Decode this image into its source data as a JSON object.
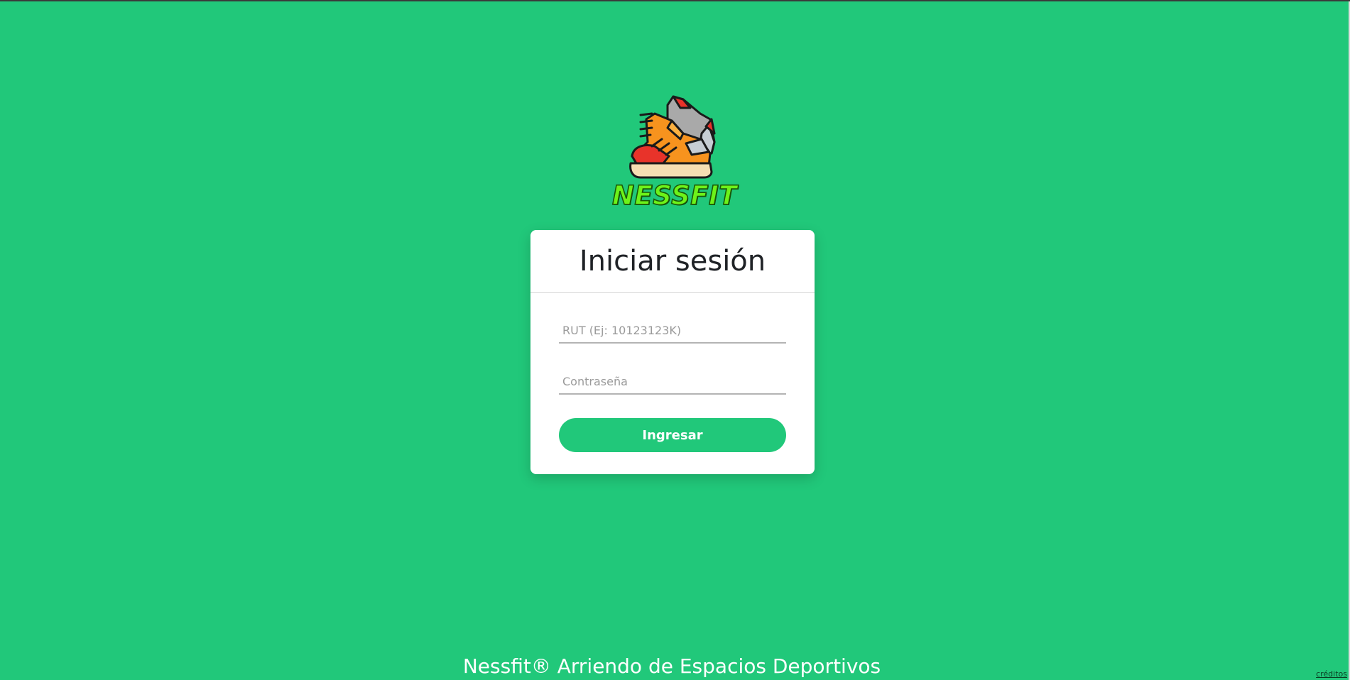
{
  "brand": {
    "logo_text": "NESSFIT",
    "logo_icon": "sneakers-icon"
  },
  "login": {
    "title": "Iniciar sesión",
    "rut_placeholder": "RUT (Ej: 10123123K)",
    "rut_value": "",
    "password_placeholder": "Contraseña",
    "password_value": "",
    "submit_label": "Ingresar"
  },
  "footer": {
    "text": "Nessfit® Arriendo de Espacios Deportivos",
    "credits_label": "créditos"
  },
  "colors": {
    "background": "#21c87a",
    "accent": "#21c87a",
    "card": "#ffffff",
    "logo_text": "#6df21a"
  }
}
